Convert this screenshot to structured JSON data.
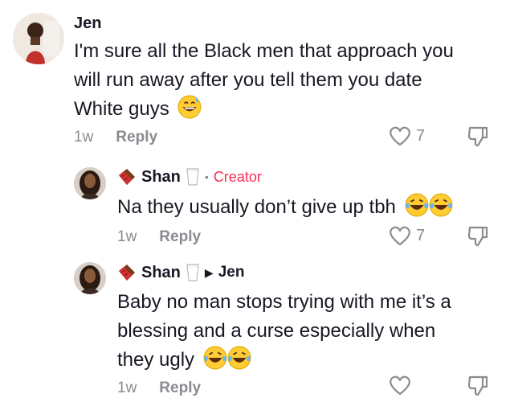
{
  "comments": [
    {
      "author": "Jen",
      "text_lines": [
        "I'm sure all the Black men that approach you",
        "will run away after you tell them you date",
        "White guys"
      ],
      "age": "1w",
      "reply_label": "Reply",
      "likes": "7"
    }
  ],
  "replies": [
    {
      "author": "Shan",
      "tag": "Creator",
      "text": "Na they usually don’t give up tbh",
      "age": "1w",
      "reply_label": "Reply",
      "likes": "7"
    },
    {
      "author": "Shan",
      "reply_to": "Jen",
      "text_lines": [
        "Baby no man stops trying with me it’s a",
        "blessing and a curse especially when",
        "they ugly"
      ],
      "age": "1w",
      "reply_label": "Reply"
    }
  ],
  "icons": {
    "heart": "heart-outline-icon",
    "dislike": "thumbs-down-icon",
    "emoji_sweat": "grinning-sweat-emoji",
    "emoji_laugh": "tears-of-joy-emoji"
  }
}
